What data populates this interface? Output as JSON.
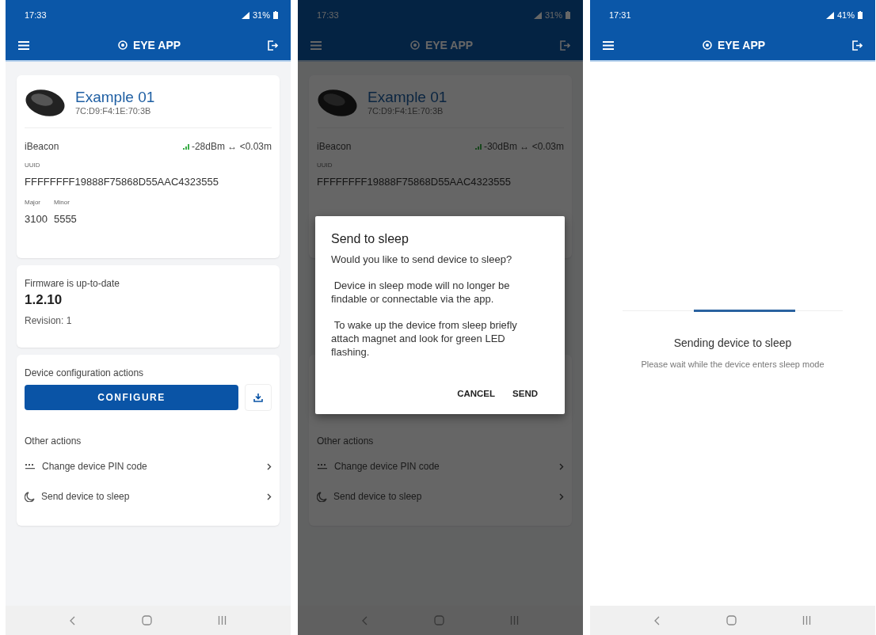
{
  "phones": [
    {
      "kind": "details",
      "status_bar": {
        "time": "17:33",
        "battery": "31%"
      },
      "app_bar": {
        "title": "EYE APP"
      },
      "device": {
        "name": "Example 01",
        "mac": "7C:D9:F4:1E:70:3B",
        "type": "iBeacon",
        "reading": "-28dBm ↔ <0.03m",
        "uuid_label": "UUID",
        "uuid": "FFFFFFFF19888F75868D55AAC4323555",
        "major_label": "Major",
        "minor_label": "Minor",
        "major": "3100",
        "minor": "5555"
      },
      "firmware": {
        "status": "Firmware is up-to-date",
        "version": "1.2.10",
        "revision": "Revision: 1"
      },
      "config": {
        "title": "Device configuration actions",
        "button": "CONFIGURE"
      },
      "other_actions": {
        "title": "Other actions",
        "items": [
          {
            "kind": "pin",
            "label": "Change device PIN code"
          },
          {
            "kind": "sleep",
            "label": "Send device to sleep"
          }
        ]
      }
    },
    {
      "kind": "details",
      "status_bar": {
        "time": "17:33",
        "battery": "31%"
      },
      "app_bar": {
        "title": "EYE APP"
      },
      "device": {
        "name": "Example 01",
        "mac": "7C:D9:F4:1E:70:3B",
        "type": "iBeacon",
        "reading": "-30dBm ↔ <0.03m",
        "uuid_label": "UUID",
        "uuid": "FFFFFFFF19888F75868D55AAC4323555"
      },
      "other_actions": {
        "title": "Other actions",
        "items": [
          {
            "kind": "pin",
            "label": "Change device PIN code"
          },
          {
            "kind": "sleep",
            "label": "Send device to sleep"
          }
        ]
      },
      "dialog": {
        "title": "Send to sleep",
        "paragraphs": [
          "Would you like to send device to sleep?",
          " Device in sleep mode will no longer be findable or connectable via the app.",
          " To wake up the device from sleep briefly attach magnet and look for green LED flashing."
        ],
        "buttons": [
          "CANCEL",
          "SEND"
        ]
      }
    },
    {
      "kind": "progress",
      "status_bar": {
        "time": "17:31",
        "battery": "41%"
      },
      "app_bar": {
        "title": "EYE APP"
      },
      "progress": {
        "title": "Sending device to sleep",
        "subtitle": "Please wait while the device enters sleep mode"
      }
    }
  ]
}
